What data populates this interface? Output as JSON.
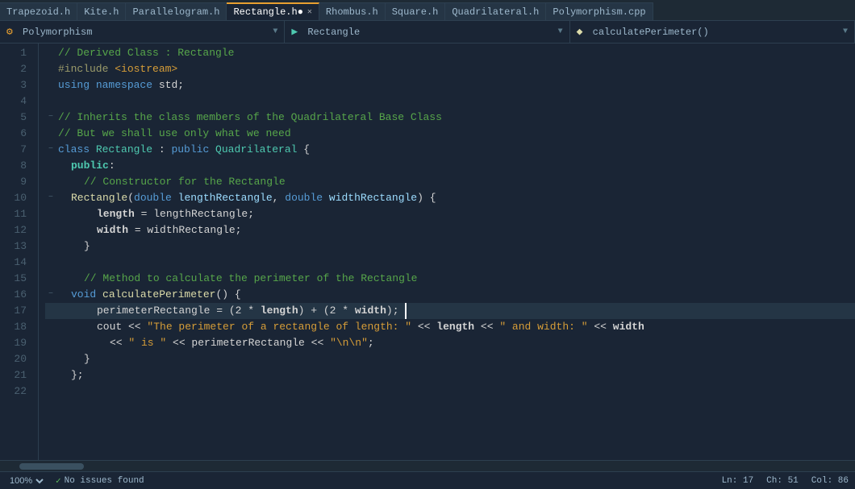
{
  "tabs": [
    {
      "id": "trapezoid",
      "label": "Trapezoid.h",
      "active": false,
      "modified": false
    },
    {
      "id": "kite",
      "label": "Kite.h",
      "active": false,
      "modified": false
    },
    {
      "id": "parallelogram",
      "label": "Parallelogram.h",
      "active": false,
      "modified": false
    },
    {
      "id": "rectangle",
      "label": "Rectangle.h",
      "active": true,
      "modified": true
    },
    {
      "id": "rhombus",
      "label": "Rhombus.h",
      "active": false,
      "modified": false
    },
    {
      "id": "square",
      "label": "Square.h",
      "active": false,
      "modified": false
    },
    {
      "id": "quadrilateral",
      "label": "Quadrilateral.h",
      "active": false,
      "modified": false
    },
    {
      "id": "polymorphism",
      "label": "Polymorphism.cpp",
      "active": false,
      "modified": false
    }
  ],
  "toolbar": {
    "namespace_icon": "⚙",
    "namespace_label": "Polymorphism",
    "class_icon": "▶",
    "class_label": "Rectangle",
    "method_icon": "◆",
    "method_label": "calculatePerimeter()"
  },
  "status": {
    "zoom": "100%",
    "issues_icon": "✓",
    "issues_text": "No issues found",
    "line": "Ln: 17",
    "col": "Ch: 51",
    "total": "Col: 86"
  },
  "lines": [
    {
      "num": "1",
      "fold": "",
      "indent": 0
    },
    {
      "num": "2",
      "fold": "",
      "indent": 0
    },
    {
      "num": "3",
      "fold": "",
      "indent": 0
    },
    {
      "num": "4",
      "fold": "",
      "indent": 0
    },
    {
      "num": "5",
      "fold": "−",
      "indent": 0
    },
    {
      "num": "6",
      "fold": "",
      "indent": 0
    },
    {
      "num": "7",
      "fold": "−",
      "indent": 0
    },
    {
      "num": "8",
      "fold": "",
      "indent": 1
    },
    {
      "num": "9",
      "fold": "",
      "indent": 1
    },
    {
      "num": "10",
      "fold": "−",
      "indent": 1
    },
    {
      "num": "11",
      "fold": "",
      "indent": 2
    },
    {
      "num": "12",
      "fold": "",
      "indent": 2
    },
    {
      "num": "13",
      "fold": "",
      "indent": 1
    },
    {
      "num": "14",
      "fold": "",
      "indent": 0
    },
    {
      "num": "15",
      "fold": "",
      "indent": 1
    },
    {
      "num": "16",
      "fold": "−",
      "indent": 1
    },
    {
      "num": "17",
      "fold": "",
      "indent": 2
    },
    {
      "num": "18",
      "fold": "",
      "indent": 2
    },
    {
      "num": "19",
      "fold": "",
      "indent": 2
    },
    {
      "num": "20",
      "fold": "",
      "indent": 1
    },
    {
      "num": "21",
      "fold": "",
      "indent": 0
    },
    {
      "num": "22",
      "fold": "",
      "indent": 0
    }
  ]
}
